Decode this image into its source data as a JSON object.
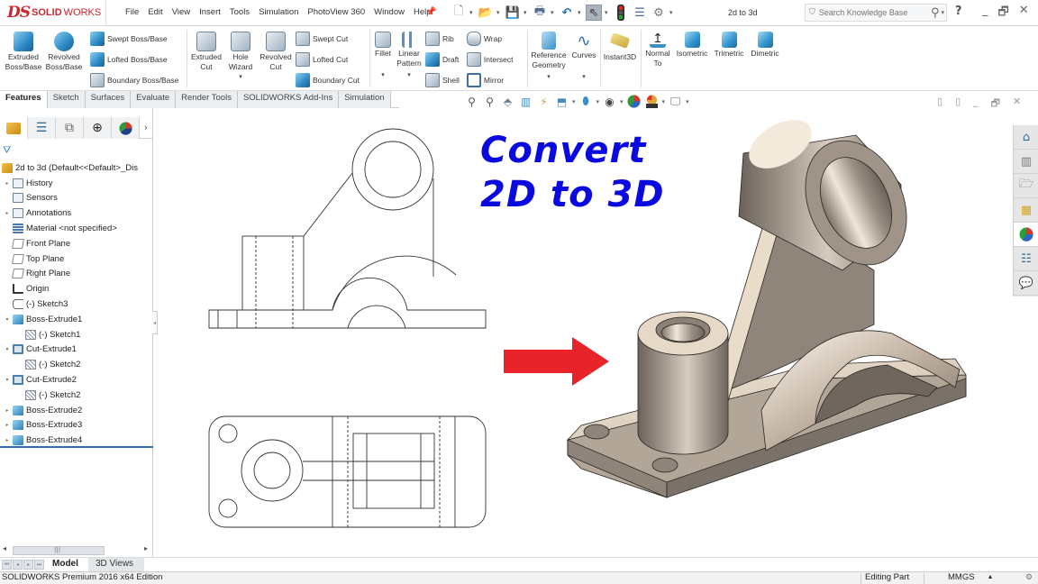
{
  "app": {
    "logo_ds": "DS",
    "logo_solid": "SOLID",
    "logo_works": "WORKS",
    "document_title": "2d to 3d"
  },
  "menu": [
    "File",
    "Edit",
    "View",
    "Insert",
    "Tools",
    "Simulation",
    "PhotoView 360",
    "Window",
    "Help"
  ],
  "quick_access": [
    {
      "name": "new-document",
      "glyph": "🗋"
    },
    {
      "name": "open",
      "glyph": "📂"
    },
    {
      "name": "save",
      "glyph": "💾"
    },
    {
      "name": "print",
      "glyph": "🖶"
    },
    {
      "name": "undo",
      "glyph": "↶"
    },
    {
      "name": "select",
      "glyph": "⇖"
    },
    {
      "name": "rebuild",
      "glyph": "🚦"
    },
    {
      "name": "file-properties",
      "glyph": "☰"
    },
    {
      "name": "options",
      "glyph": "⚙"
    }
  ],
  "search": {
    "placeholder": "Search Knowledge Base"
  },
  "help": "?",
  "window_controls": [
    "_",
    "🗗",
    "✕"
  ],
  "command_manager": {
    "extruded_boss": "Extruded Boss/Base",
    "revolved_boss": "Revolved Boss/Base",
    "swept_boss": "Swept Boss/Base",
    "lofted_boss": "Lofted Boss/Base",
    "boundary_boss": "Boundary Boss/Base",
    "extruded_cut": "Extruded Cut",
    "hole_wizard": "Hole Wizard",
    "revolved_cut": "Revolved Cut",
    "swept_cut": "Swept Cut",
    "lofted_cut": "Lofted Cut",
    "boundary_cut": "Boundary Cut",
    "fillet": "Fillet",
    "linear_pattern": "Linear Pattern",
    "rib": "Rib",
    "draft": "Draft",
    "shell": "Shell",
    "wrap": "Wrap",
    "intersect": "Intersect",
    "mirror": "Mirror",
    "reference_geometry": "Reference Geometry",
    "curves": "Curves",
    "instant3d": "Instant3D",
    "normal_to": "Normal To",
    "isometric": "Isometric",
    "trimetric": "Trimetric",
    "dimetric": "Dimetric"
  },
  "tabs": [
    "Features",
    "Sketch",
    "Surfaces",
    "Evaluate",
    "Render Tools",
    "SOLIDWORKS Add-Ins",
    "Simulation"
  ],
  "active_tab": "Features",
  "panel_tabs": [
    "FeatureManager",
    "PropertyManager",
    "ConfigurationManager",
    "DimXpertManager",
    "DisplayManager"
  ],
  "tree": [
    {
      "label": "2d to 3d  (Default<<Default>_Dis",
      "icon": "part",
      "arrow": "",
      "indent": 0
    },
    {
      "label": "History",
      "icon": "folder",
      "arrow": "▸",
      "indent": 1
    },
    {
      "label": "Sensors",
      "icon": "folder",
      "arrow": "",
      "indent": 1
    },
    {
      "label": "Annotations",
      "icon": "folder",
      "arrow": "▸",
      "indent": 1
    },
    {
      "label": "Material <not specified>",
      "icon": "mat",
      "arrow": "",
      "indent": 1
    },
    {
      "label": "Front Plane",
      "icon": "plane",
      "arrow": "",
      "indent": 1
    },
    {
      "label": "Top Plane",
      "icon": "plane",
      "arrow": "",
      "indent": 1
    },
    {
      "label": "Right Plane",
      "icon": "plane",
      "arrow": "",
      "indent": 1
    },
    {
      "label": "Origin",
      "icon": "origin",
      "arrow": "",
      "indent": 1
    },
    {
      "label": "(-) Sketch3",
      "icon": "sketch",
      "arrow": "",
      "indent": 1
    },
    {
      "label": "Boss-Extrude1",
      "icon": "boss",
      "arrow": "▾",
      "indent": 1
    },
    {
      "label": "(-) Sketch1",
      "icon": "sk2",
      "arrow": "",
      "indent": 2
    },
    {
      "label": "Cut-Extrude1",
      "icon": "cut",
      "arrow": "▾",
      "indent": 1
    },
    {
      "label": "(-) Sketch2",
      "icon": "sk2",
      "arrow": "",
      "indent": 2
    },
    {
      "label": "Cut-Extrude2",
      "icon": "cut",
      "arrow": "▾",
      "indent": 1
    },
    {
      "label": "(-) Sketch2",
      "icon": "sk2",
      "arrow": "",
      "indent": 2
    },
    {
      "label": "Boss-Extrude2",
      "icon": "boss",
      "arrow": "▸",
      "indent": 1
    },
    {
      "label": "Boss-Extrude3",
      "icon": "boss",
      "arrow": "▸",
      "indent": 1
    },
    {
      "label": "Boss-Extrude4",
      "icon": "boss",
      "arrow": "▸",
      "indent": 1
    }
  ],
  "bottom_tabs": {
    "model": "Model",
    "views3d": "3D Views"
  },
  "status": {
    "edition": "SOLIDWORKS Premium 2016 x64 Edition",
    "mode": "Editing Part",
    "units": "MMGS"
  },
  "headline": {
    "line1": "Convert",
    "line2": "2D to 3D"
  },
  "colors": {
    "headline": "#0a0ade",
    "arrow": "#e8232a",
    "brand_red": "#c9282d",
    "tree_accent": "#2f6fb7",
    "model_metal": "#a59a8f"
  }
}
